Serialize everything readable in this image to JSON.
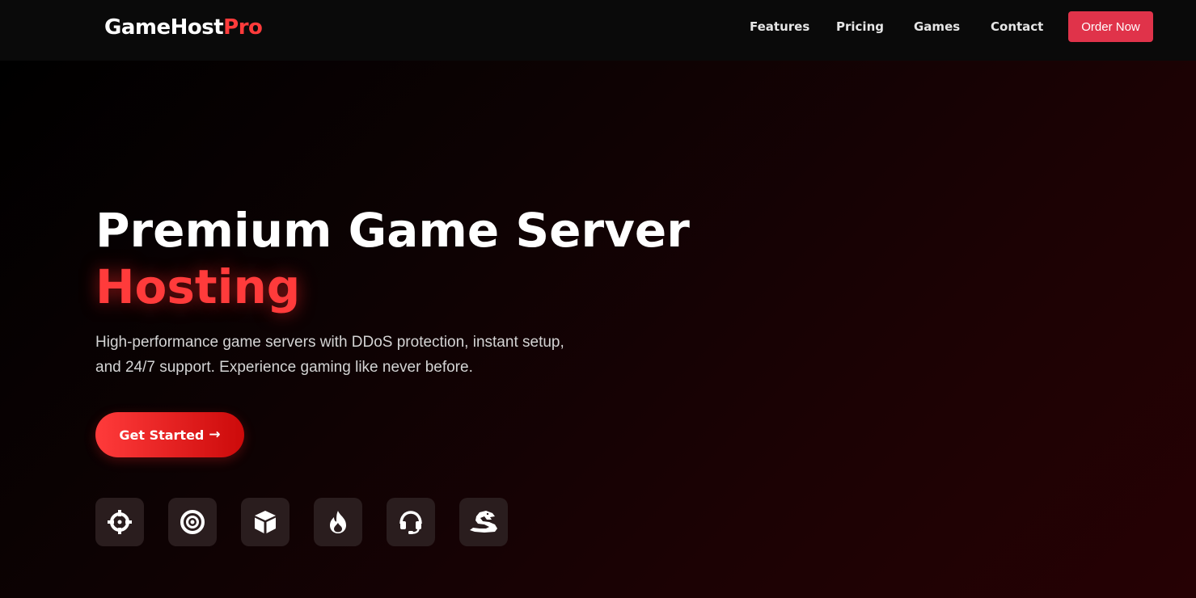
{
  "brand": {
    "name_main": "GameHost",
    "name_accent": "Pro"
  },
  "nav": {
    "items": [
      {
        "label": "Features"
      },
      {
        "label": "Pricing"
      },
      {
        "label": "Games"
      },
      {
        "label": "Contact"
      }
    ],
    "cta_label": "Order Now"
  },
  "hero": {
    "title_line1": "Premium Game Server",
    "title_line2": "Hosting",
    "subtitle": "High-performance game servers with DDoS protection, instant setup, and 24/7 support. Experience gaming like never before.",
    "cta_label": "Get Started",
    "cta_arrow": "→"
  },
  "game_icons": [
    {
      "icon": "crosshairs-icon"
    },
    {
      "icon": "bullseye-icon"
    },
    {
      "icon": "cube-icon"
    },
    {
      "icon": "fire-icon"
    },
    {
      "icon": "headset-icon"
    },
    {
      "icon": "dragon-icon"
    }
  ],
  "colors": {
    "accent": "#ff3b3b",
    "order_button": "#e0334a",
    "navbar_bg": "#0a0a0a",
    "icon_tile_bg": "#2a1d1e"
  }
}
